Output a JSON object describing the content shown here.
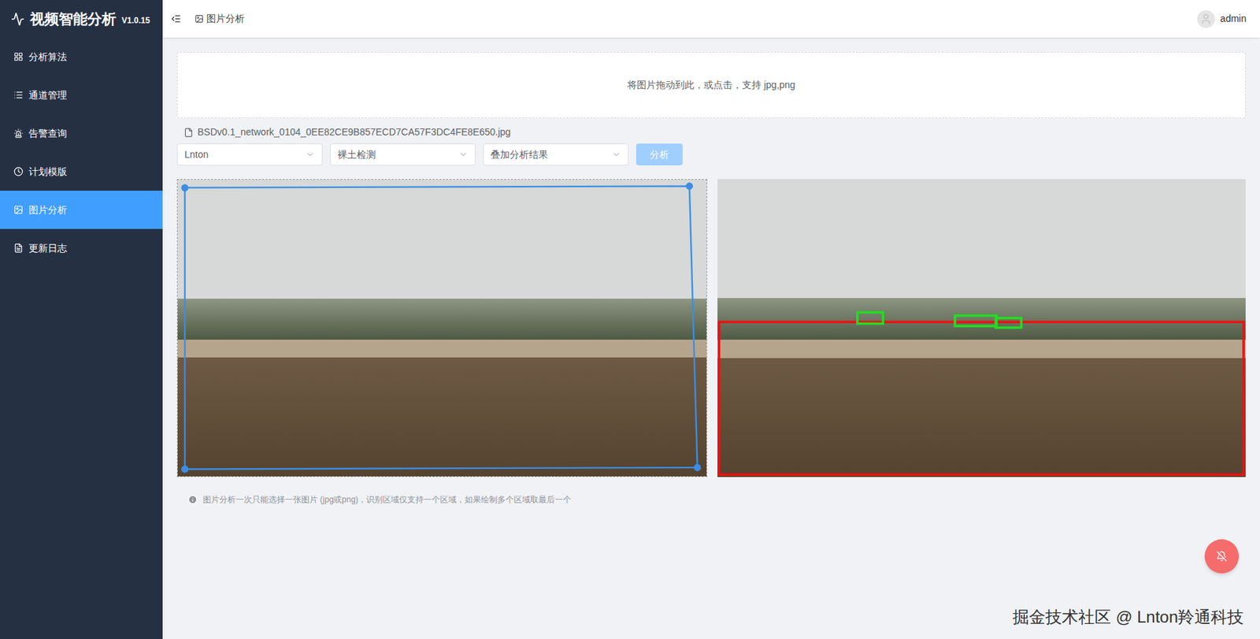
{
  "sidebar": {
    "title": "视频智能分析",
    "version": "V1.0.15",
    "items": [
      {
        "label": "分析算法",
        "selected": false
      },
      {
        "label": "通道管理",
        "selected": false
      },
      {
        "label": "告警查询",
        "selected": false
      },
      {
        "label": "计划模版",
        "selected": false
      },
      {
        "label": "图片分析",
        "selected": true
      },
      {
        "label": "更新日志",
        "selected": false
      }
    ]
  },
  "header": {
    "breadcrumb": "图片分析",
    "user": "admin"
  },
  "upload": {
    "text": "将图片拖动到此，或点击，支持 jpg,png"
  },
  "file": {
    "name": "BSDv0.1_network_0104_0EE82CE9B857ECD7CA57F3DC4FE8E650.jpg"
  },
  "selects": [
    {
      "value": "Lnton"
    },
    {
      "value": "裸土检测"
    },
    {
      "value": "叠加分析结果"
    }
  ],
  "analyze_button": {
    "label": "分析",
    "disabled": true
  },
  "hint": "图片分析一次只能选择一张图片 (jpg或png)，识别区域仅支持一个区域，如果绘制多个区域取最后一个",
  "watermark": "掘金技术社区 @ Lnton羚通科技"
}
